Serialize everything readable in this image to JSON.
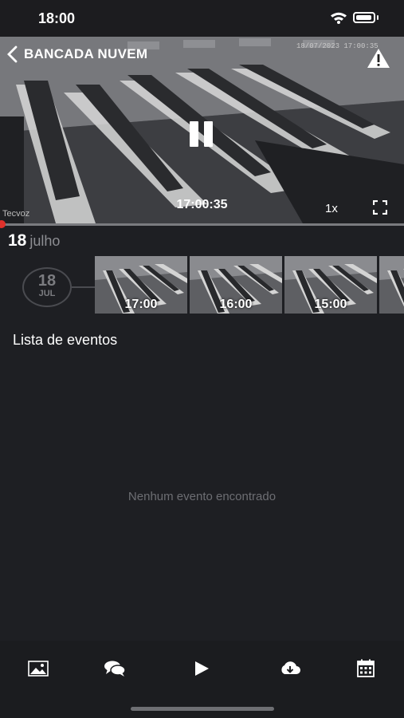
{
  "status_bar": {
    "time": "18:00"
  },
  "header": {
    "title": "BANCADA NUVEM"
  },
  "camera": {
    "timestamp": "18/07/2023 17:00:35",
    "brand": "Tecvoz"
  },
  "player": {
    "current_time": "17:00:35",
    "speed": "1x",
    "progress": 0.0
  },
  "date_section": {
    "day": "18",
    "month": "julho"
  },
  "day_badge": {
    "day": "18",
    "month_abbr": "JUL"
  },
  "thumbnails": [
    {
      "label": "17:00",
      "selected": true
    },
    {
      "label": "16:00",
      "selected": false
    },
    {
      "label": "15:00",
      "selected": false
    },
    {
      "label": "",
      "selected": false
    }
  ],
  "events": {
    "title": "Lista de eventos",
    "empty_message": "Nenhum evento encontrado"
  },
  "bottom_nav": {
    "items": [
      {
        "icon": "image-icon"
      },
      {
        "icon": "chat-icon"
      },
      {
        "icon": "play-icon"
      },
      {
        "icon": "cloud-download-icon"
      },
      {
        "icon": "calendar-icon"
      }
    ]
  },
  "colors": {
    "accent_blue": "#2c8cf0",
    "progress_red": "#e0312b",
    "background": "#1e1f23"
  }
}
